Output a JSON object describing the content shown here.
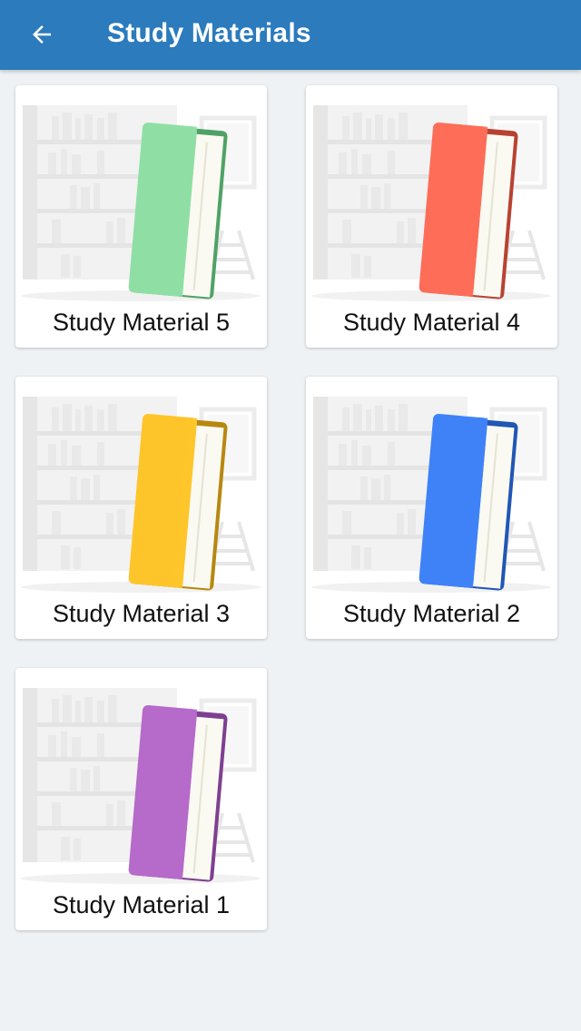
{
  "appbar": {
    "title": "Study Materials",
    "back_icon": "arrow-left-icon",
    "background": "#2b7bbd"
  },
  "materials": [
    {
      "label": "Study Material 5",
      "color": "#8fdfa5",
      "edge": "#4fa266",
      "icon": "book-icon"
    },
    {
      "label": "Study Material 4",
      "color": "#fe6d58",
      "edge": "#b84232",
      "icon": "book-icon"
    },
    {
      "label": "Study Material 3",
      "color": "#fec52a",
      "edge": "#b78810",
      "icon": "book-icon"
    },
    {
      "label": "Study Material 2",
      "color": "#3f82f8",
      "edge": "#2157b5",
      "icon": "book-icon"
    },
    {
      "label": "Study Material 1",
      "color": "#b66ac9",
      "edge": "#7f3f91",
      "icon": "book-icon"
    }
  ]
}
